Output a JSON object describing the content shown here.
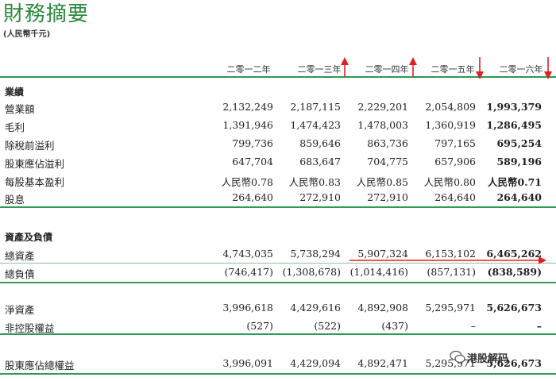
{
  "title": "財務摘要",
  "unit": "(人民幣千元)",
  "years": [
    "二零一二年",
    "二零一三年",
    "二零一四年",
    "二零一五年",
    "二零一六年"
  ],
  "sections": [
    {
      "heading": "業績",
      "rows": [
        {
          "label": "營業額",
          "values": [
            "2,132,249",
            "2,187,115",
            "2,229,201",
            "2,054,809",
            "1,993,379"
          ]
        },
        {
          "label": "毛利",
          "values": [
            "1,391,946",
            "1,474,423",
            "1,478,003",
            "1,360,919",
            "1,286,495"
          ]
        },
        {
          "label": "除稅前溢利",
          "values": [
            "799,736",
            "859,646",
            "863,736",
            "797,165",
            "695,254"
          ]
        },
        {
          "label": "股東應佔溢利",
          "values": [
            "647,704",
            "683,647",
            "704,775",
            "657,906",
            "589,196"
          ]
        },
        {
          "label": "每股基本盈利",
          "values": [
            "人民幣0.78",
            "人民幣0.83",
            "人民幣0.85",
            "人民幣0.80",
            "人民幣0.71"
          ]
        },
        {
          "label": "股息",
          "values": [
            "264,640",
            "272,910",
            "272,910",
            "264,640",
            "264,640"
          ]
        }
      ]
    },
    {
      "heading": "資產及負債",
      "rows": [
        {
          "label": "總資產",
          "values": [
            "4,743,035",
            "5,738,294",
            "5,907,324",
            "6,153,102",
            "6,465,262"
          ]
        },
        {
          "label": "總負債",
          "values": [
            "(746,417)",
            "(1,308,678)",
            "(1,014,416)",
            "(857,131)",
            "(838,589)"
          ]
        }
      ]
    },
    {
      "heading": "",
      "rows": [
        {
          "label": "淨資產",
          "values": [
            "3,996,618",
            "4,429,616",
            "4,892,908",
            "5,295,971",
            "5,626,673"
          ]
        },
        {
          "label": "非控股權益",
          "values": [
            "(527)",
            "(522)",
            "(437)",
            "–",
            "–"
          ]
        }
      ]
    },
    {
      "heading": "",
      "rows": [
        {
          "label": "股東應佔總權益",
          "values": [
            "3,996,091",
            "4,429,094",
            "4,892,471",
            "5,295,971",
            "5,626,673"
          ]
        }
      ]
    }
  ],
  "watermark": "港股解码",
  "colors": {
    "accent": "#2c8a3c",
    "rule": "#2d9b52",
    "annotation": "#e02020"
  }
}
